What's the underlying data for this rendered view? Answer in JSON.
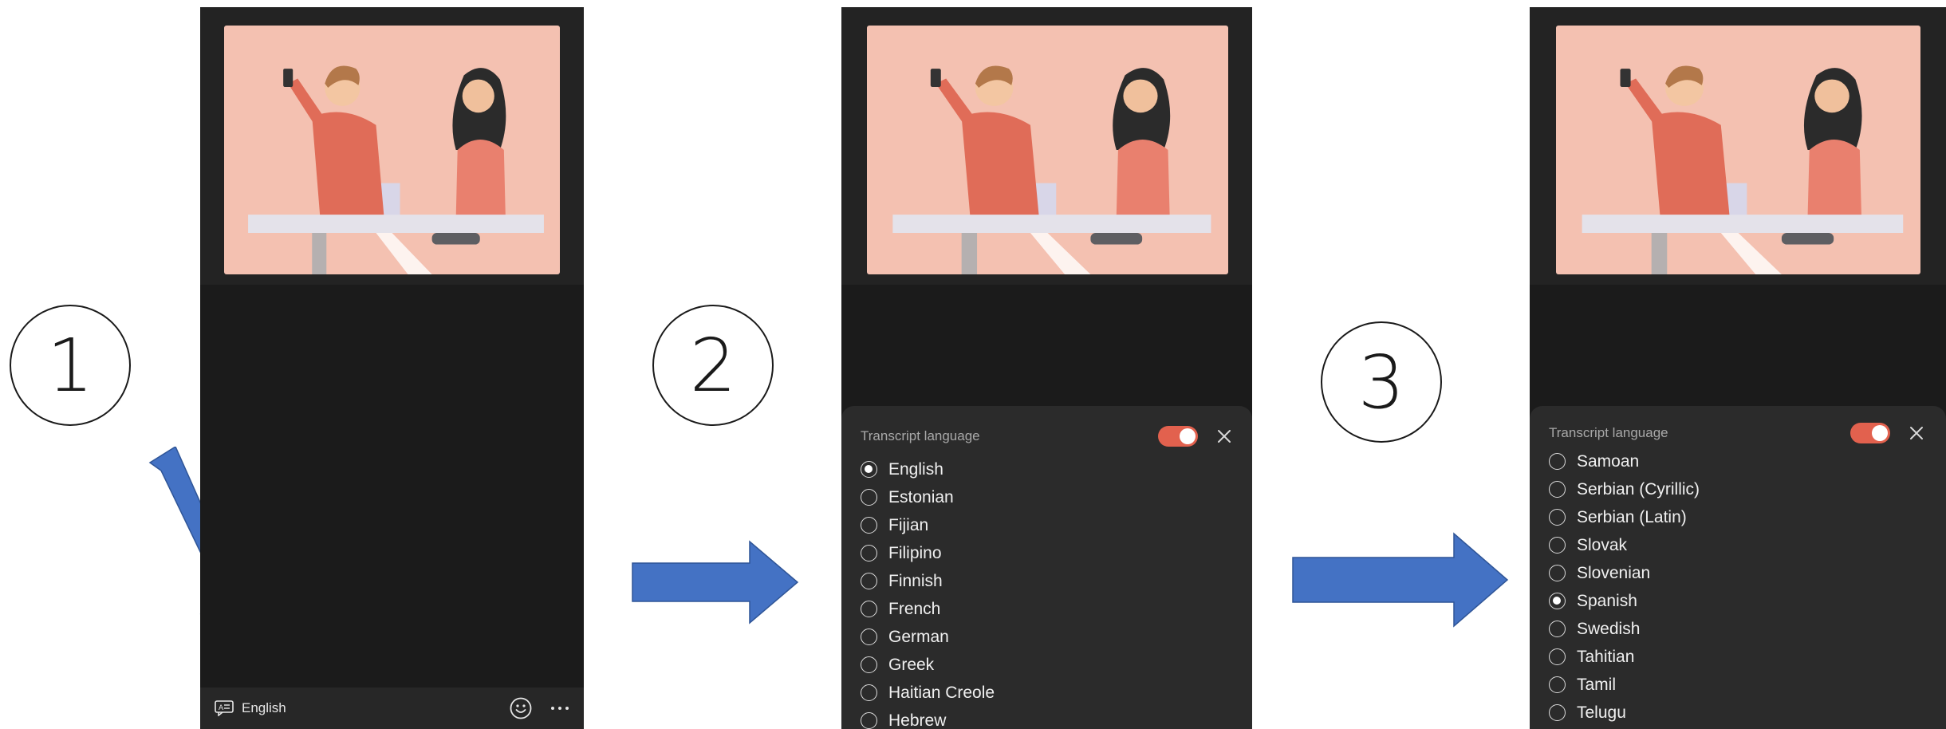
{
  "steps": [
    "1",
    "2",
    "3"
  ],
  "panel1": {
    "bottom_bar": {
      "language_label": "English",
      "language_icon": "captions-icon",
      "emoji_icon": "smiley-icon",
      "more_icon": "more-dots-icon"
    }
  },
  "panel2": {
    "sheet": {
      "title": "Transcript language",
      "toggle_on": true,
      "close_icon": "close-icon",
      "languages": [
        {
          "label": "English",
          "selected": true
        },
        {
          "label": "Estonian",
          "selected": false
        },
        {
          "label": "Fijian",
          "selected": false
        },
        {
          "label": "Filipino",
          "selected": false
        },
        {
          "label": "Finnish",
          "selected": false
        },
        {
          "label": "French",
          "selected": false
        },
        {
          "label": "German",
          "selected": false
        },
        {
          "label": "Greek",
          "selected": false
        },
        {
          "label": "Haitian Creole",
          "selected": false
        },
        {
          "label": "Hebrew",
          "selected": false
        }
      ]
    }
  },
  "panel3": {
    "sheet": {
      "title": "Transcript language",
      "toggle_on": true,
      "close_icon": "close-icon",
      "languages": [
        {
          "label": "Samoan",
          "selected": false
        },
        {
          "label": "Serbian (Cyrillic)",
          "selected": false
        },
        {
          "label": "Serbian (Latin)",
          "selected": false
        },
        {
          "label": "Slovak",
          "selected": false
        },
        {
          "label": "Slovenian",
          "selected": false
        },
        {
          "label": "Spanish",
          "selected": true
        },
        {
          "label": "Swedish",
          "selected": false
        },
        {
          "label": "Tahitian",
          "selected": false
        },
        {
          "label": "Tamil",
          "selected": false
        },
        {
          "label": "Telugu",
          "selected": false
        }
      ]
    }
  },
  "colors": {
    "arrow": "#4472c4",
    "toggle": "#e2614e",
    "phone_bg": "#1b1b1b",
    "sheet_bg": "#2b2b2b",
    "illustration_bg": "#f4c1b1"
  }
}
